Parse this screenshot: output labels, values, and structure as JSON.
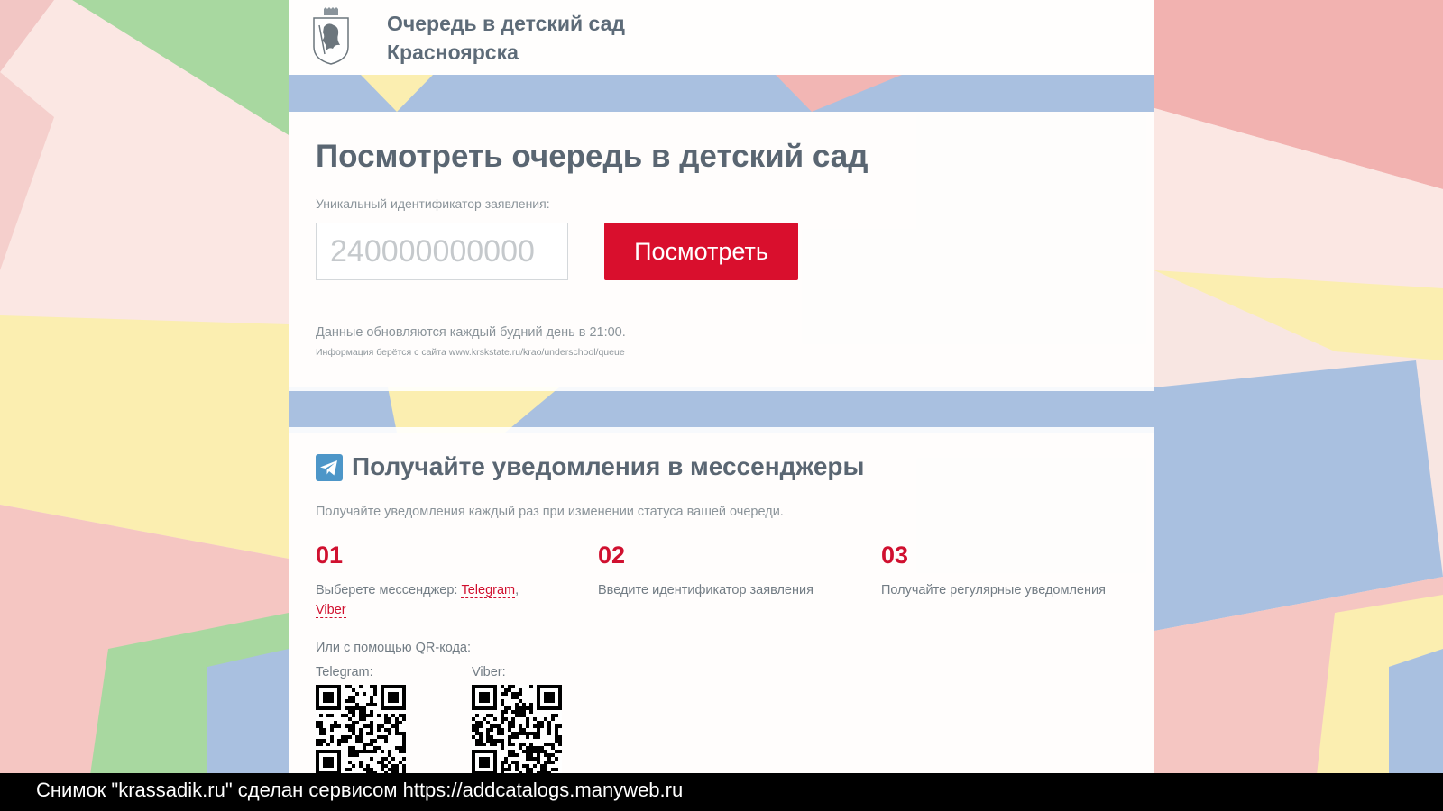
{
  "colors": {
    "accent": "#d90f2d",
    "heading": "#5a6672",
    "muted": "#8a9399"
  },
  "header": {
    "crest_icon": "coat-of-arms-icon",
    "title_line1": "Очередь в детский сад",
    "title_line2": "Красноярска"
  },
  "lookup": {
    "title": "Посмотреть очередь в детский сад",
    "id_label": "Уникальный идентификатор заявления:",
    "id_value": "",
    "id_placeholder": "240000000000",
    "button": "Посмотреть",
    "update_note": "Данные обновляются каждый будний день в 21:00.",
    "source_note": "Информация берётся с сайта www.krskstate.ru/krao/underschool/queue"
  },
  "notify": {
    "icon": "telegram-icon",
    "title": "Получайте уведомления в мессенджеры",
    "subtitle": "Получайте уведомления каждый раз при изменении статуса вашей очереди.",
    "steps": [
      {
        "num": "01",
        "text_prefix": "Выберете мессенджер: ",
        "link1": "Telegram",
        "sep": ",",
        "link2": "Viber"
      },
      {
        "num": "02",
        "text": "Введите идентификатор заявления"
      },
      {
        "num": "03",
        "text": "Получайте регулярные уведомления"
      }
    ],
    "qr_intro": "Или с помощью QR-кода:",
    "qr_telegram_label": "Telegram:",
    "qr_viber_label": "Viber:"
  },
  "footer": {
    "text": "Снимок \"krassadik.ru\" сделан сервисом https://addcatalogs.manyweb.ru"
  }
}
